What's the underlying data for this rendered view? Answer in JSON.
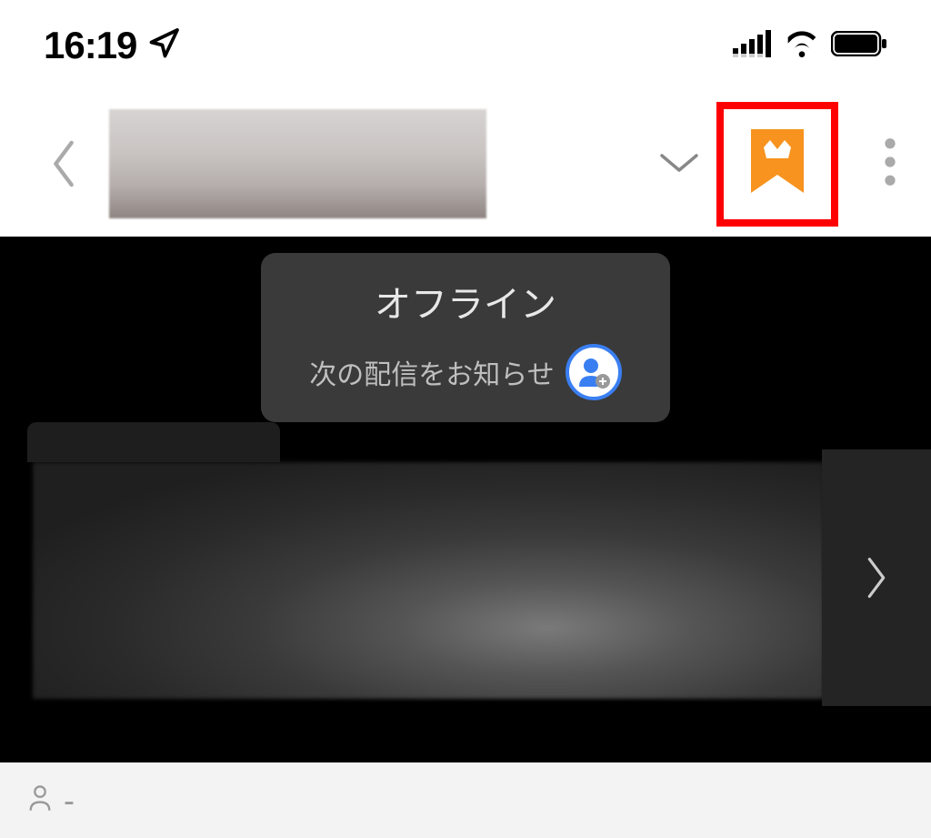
{
  "statusBar": {
    "time": "16:19"
  },
  "header": {
    "crownIconName": "crown-bookmark-icon"
  },
  "offlineCard": {
    "title": "オフライン",
    "subtitle": "次の配信をお知らせ"
  },
  "bottomBar": {
    "viewerCount": "-"
  },
  "colors": {
    "highlight": "#ff0000",
    "crown": "#f7931e",
    "followBorder": "#3a7ff2"
  }
}
